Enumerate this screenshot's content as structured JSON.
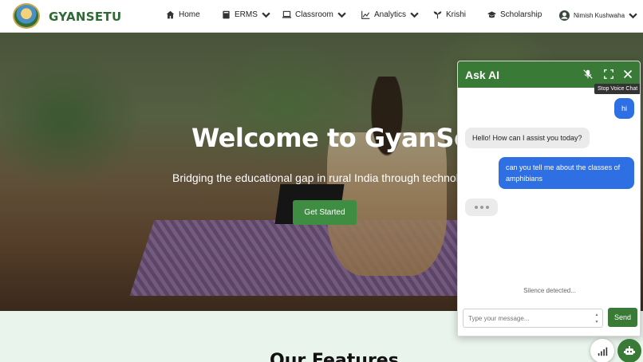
{
  "brand": {
    "name": "GYANSETU"
  },
  "nav": {
    "home": "Home",
    "erms": "ERMS",
    "classroom": "Classroom",
    "analytics": "Analytics",
    "krishi": "Krishi",
    "scholarship": "Scholarship",
    "user": "Nimish Kushwaha"
  },
  "hero": {
    "title": "Welcome to GyanSetu",
    "subtitle": "Bridging the educational gap in rural India through technol",
    "cta": "Get Started"
  },
  "features": {
    "title": "Our Features"
  },
  "chat": {
    "title": "Ask AI",
    "tooltip": "Stop Voice Chat",
    "messages": [
      {
        "from": "user",
        "text": "hi"
      },
      {
        "from": "bot",
        "text": "Hello! How can I assist you today?"
      },
      {
        "from": "user",
        "text": "can you tell me about the classes of amphibians"
      }
    ],
    "status": "Silence detected...",
    "input_placeholder": "Type your message...",
    "send": "Send"
  },
  "colors": {
    "brand_green": "#2e6b34",
    "chat_header": "#3a7a37",
    "user_bubble": "#2f6fe4",
    "bot_bubble": "#ebebeb",
    "features_bg": "#e9f4ec"
  },
  "icons": [
    "home-icon",
    "book-icon",
    "laptop-icon",
    "chart-icon",
    "sprout-icon",
    "graduation-cap-icon",
    "user-circle-icon",
    "mic-off-icon",
    "expand-icon",
    "close-icon",
    "signal-icon",
    "robot-icon"
  ]
}
